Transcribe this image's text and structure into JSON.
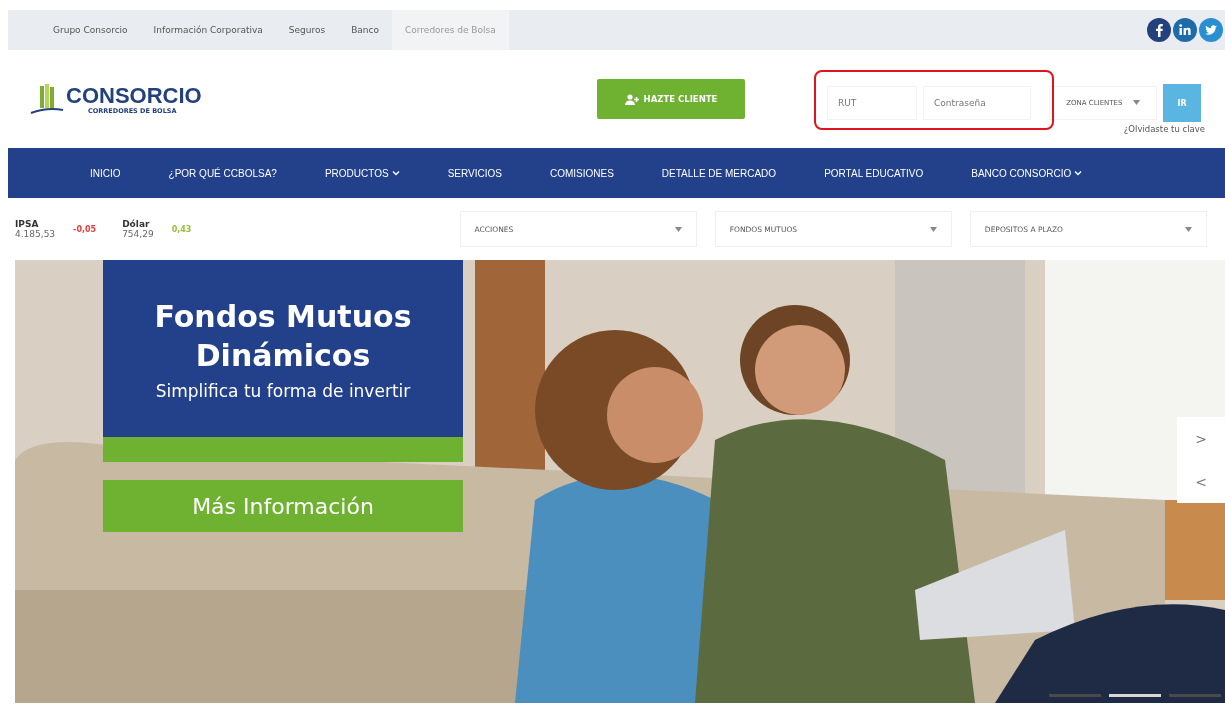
{
  "top_bar": {
    "links": [
      {
        "label": "Grupo Consorcio",
        "selected": false
      },
      {
        "label": "Información Corporativa",
        "selected": false
      },
      {
        "label": "Seguros",
        "selected": false
      },
      {
        "label": "Banco",
        "selected": false
      },
      {
        "label": "Corredores de Bolsa",
        "selected": true
      }
    ]
  },
  "header": {
    "logo": {
      "name": "CONSORCIO",
      "tagline": "CORREDORES DE BOLSA"
    },
    "cta": "HAZTE CLIENTE",
    "login": {
      "rut_placeholder": "RUT",
      "password_placeholder": "Contraseña",
      "zone": "ZONA CLIENTES",
      "submit": "IR",
      "forgot": "¿Olvidaste tu clave",
      "highlighted": true
    }
  },
  "nav": [
    {
      "label": "INICIO",
      "dropdown": false
    },
    {
      "label": "¿POR QUÉ CCBOLSA?",
      "dropdown": false
    },
    {
      "label": "PRODUCTOS",
      "dropdown": true
    },
    {
      "label": "SERVICIOS",
      "dropdown": false
    },
    {
      "label": "COMISIONES",
      "dropdown": false
    },
    {
      "label": "DETALLE DE MERCADO",
      "dropdown": false
    },
    {
      "label": "PORTAL EDUCATIVO",
      "dropdown": false
    },
    {
      "label": "BANCO CONSORCIO",
      "dropdown": true
    }
  ],
  "tickers": [
    {
      "name": "IPSA",
      "value": "4.185,53",
      "change": "-0,05",
      "color": "#e0403c"
    },
    {
      "name": "Dólar",
      "value": "754,29",
      "change": "0,43",
      "color": "#9bbf3a"
    }
  ],
  "selects": [
    {
      "label": "ACCIONES"
    },
    {
      "label": "FONDOS MUTUOS"
    },
    {
      "label": "DEPOSITOS A PLAZO"
    }
  ],
  "hero": {
    "title": "Fondos Mutuos Dinámicos",
    "subtitle": "Simplifica tu forma de invertir",
    "button": "Más Información",
    "next": ">",
    "prev": "<",
    "slides": [
      {
        "selected": false
      },
      {
        "selected": true
      },
      {
        "selected": false
      }
    ]
  }
}
